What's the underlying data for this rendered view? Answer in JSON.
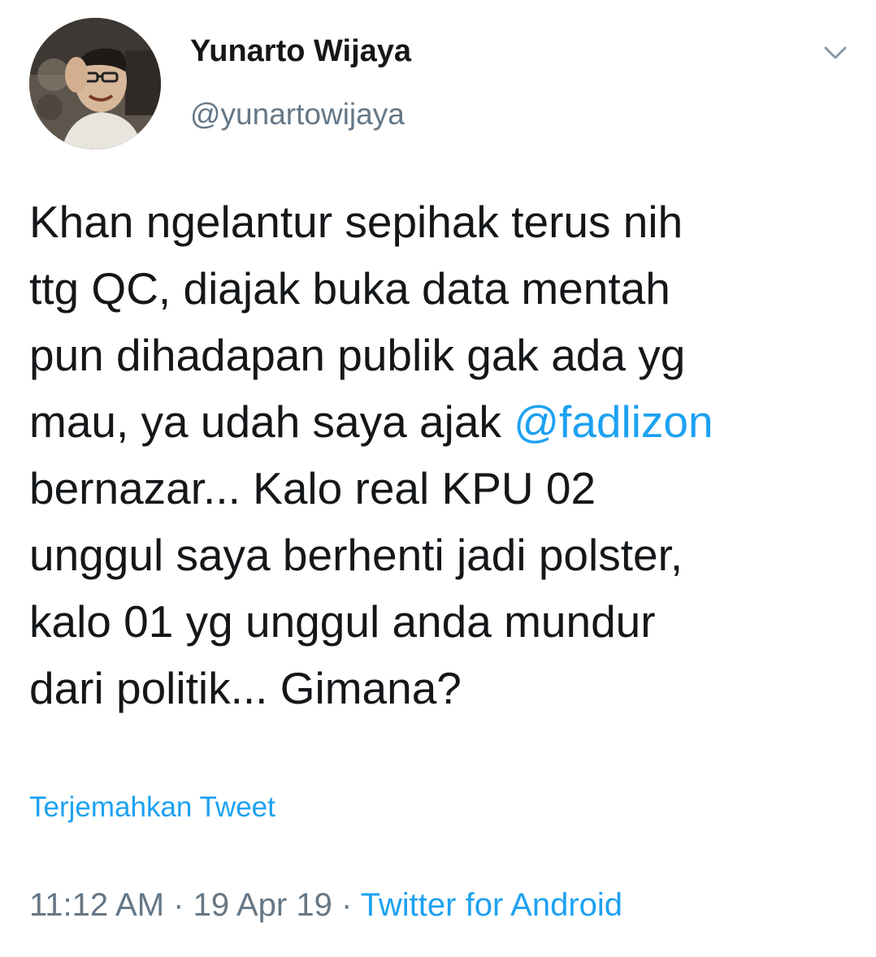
{
  "author": {
    "display_name": "Yunarto Wijaya",
    "handle": "@yunartowijaya",
    "avatar_icon": "profile-photo"
  },
  "menu": {
    "icon": "chevron-down-icon"
  },
  "tweet": {
    "lines": [
      "Khan ngelantur sepihak terus nih",
      "ttg QC, diajak buka data mentah",
      "pun dihadapan publik gak ada yg",
      "mau, ya udah saya ajak ",
      "bernazar... Kalo real KPU 02",
      "unggul saya berhenti jadi polster,",
      "kalo 01 yg unggul anda mundur",
      "dari politik... Gimana?"
    ],
    "mention": "@fadlizon"
  },
  "translate_label": "Terjemahkan Tweet",
  "meta": {
    "time": "11:12 AM",
    "separator": " · ",
    "date": "19 Apr 19",
    "source": "Twitter for Android"
  },
  "colors": {
    "link": "#1da1f2",
    "secondary": "#657786",
    "text": "#14171a"
  }
}
